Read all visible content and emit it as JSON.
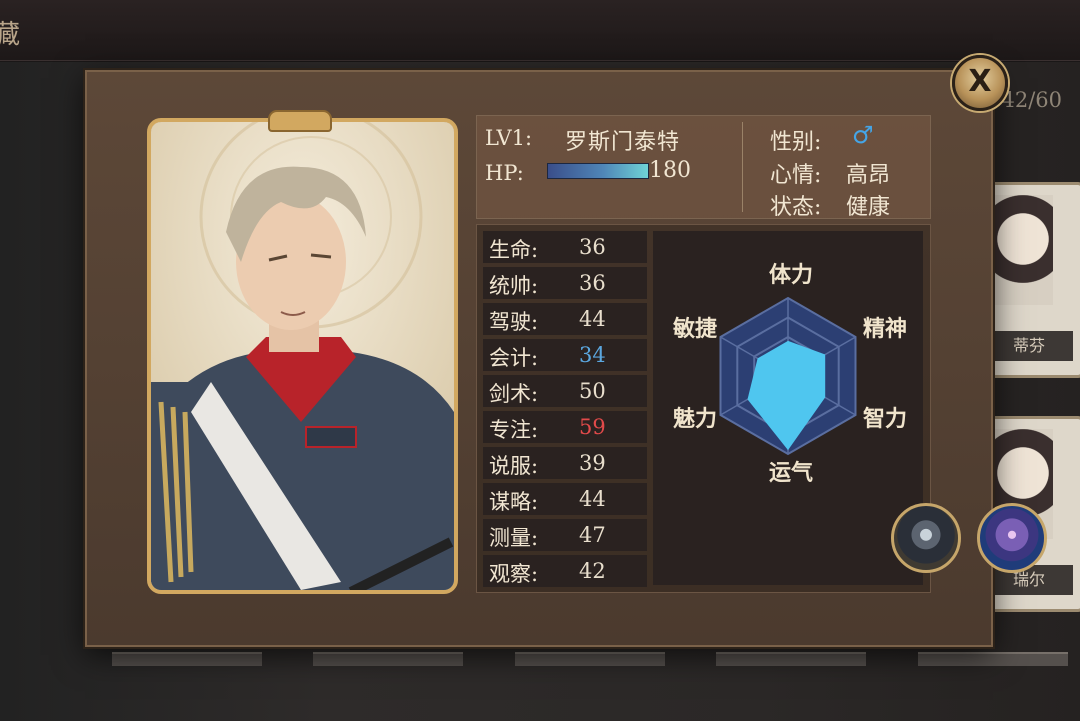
{
  "background": {
    "title_fragment": "藏",
    "counter": "42/60",
    "cards": [
      "蒂芬",
      "瑞尔"
    ]
  },
  "close_icon": "close-x-icon",
  "character": {
    "level": "LV1:",
    "name": "罗斯门泰特",
    "hp_label": "HP:",
    "hp_value": "180",
    "hp_fraction": 0.72,
    "gender_label": "性别:",
    "gender_icon": "♂",
    "mood_label": "心情:",
    "mood_value": "高昂",
    "state_label": "状态:",
    "state_value": "健康"
  },
  "stats": [
    {
      "label": "生命:",
      "value": "36"
    },
    {
      "label": "统帅:",
      "value": "36"
    },
    {
      "label": "驾驶:",
      "value": "44"
    },
    {
      "label": "会计:",
      "value": "34",
      "color": "blue"
    },
    {
      "label": "剑术:",
      "value": "50"
    },
    {
      "label": "专注:",
      "value": "59",
      "color": "red"
    },
    {
      "label": "说服:",
      "value": "39"
    },
    {
      "label": "谋略:",
      "value": "44"
    },
    {
      "label": "测量:",
      "value": "47"
    },
    {
      "label": "观察:",
      "value": "42"
    }
  ],
  "radar": {
    "labels": {
      "top": "体力",
      "top_right": "精神",
      "bottom_right": "智力",
      "bottom": "运气",
      "bottom_left": "魅力",
      "top_left": "敏捷"
    },
    "fill_color": "#4fc6ef",
    "grid_color": "#2c3f73"
  },
  "skills": [
    "tower-skill-icon",
    "third-eye-skill-icon"
  ]
}
